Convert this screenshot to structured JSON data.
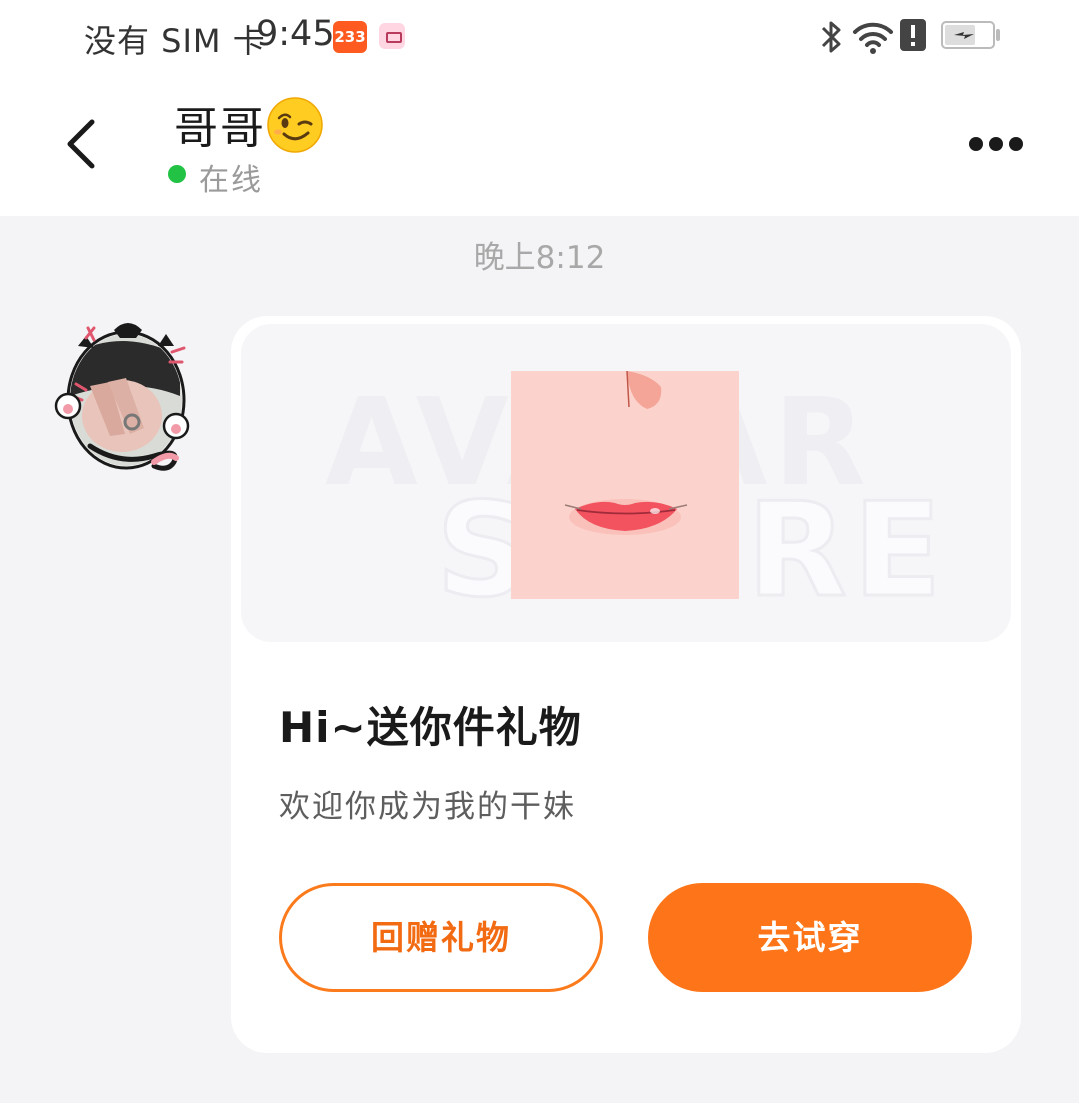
{
  "status_bar": {
    "carrier": "没有 SIM 卡",
    "time": "9:45",
    "badge_233": "233",
    "icons": [
      "bluetooth-icon",
      "wifi-icon",
      "alert-icon",
      "battery-icon"
    ]
  },
  "header": {
    "contact_name": "哥哥",
    "contact_emoji": "winking-face-emoji",
    "presence": "在线",
    "presence_color": "#22c244",
    "back_icon": "chevron-left-icon",
    "more_icon": "more-dots-icon"
  },
  "chat": {
    "timestamp": "晚上8:12"
  },
  "gift_card": {
    "watermark_line1": "AVATAR",
    "watermark_line2": "STORE",
    "title": "Hi~送你件礼物",
    "subtitle": "欢迎你成为我的干妹",
    "return_gift_label": "回赠礼物",
    "try_on_label": "去试穿",
    "accent_color": "#fd7518"
  }
}
